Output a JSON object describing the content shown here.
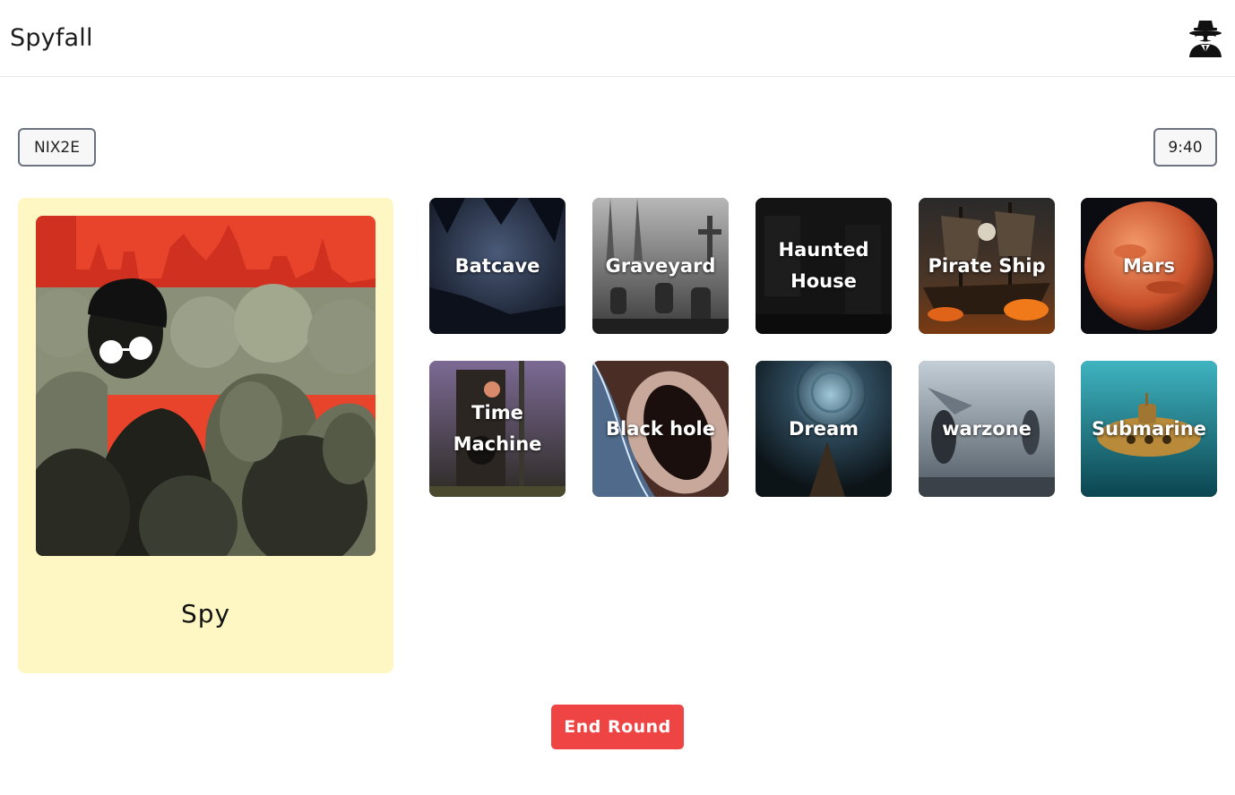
{
  "header": {
    "title": "Spyfall",
    "logo_icon": "spy-icon"
  },
  "game": {
    "room_code": "NIX2E",
    "timer": "9:40"
  },
  "role_card": {
    "role_name": "Spy",
    "image_icon": "spy-crowd-illustration"
  },
  "locations": [
    {
      "label": "Batcave"
    },
    {
      "label": "Graveyard"
    },
    {
      "label": "Haunted House"
    },
    {
      "label": "Pirate Ship"
    },
    {
      "label": "Mars"
    },
    {
      "label": "Time Machine"
    },
    {
      "label": "Black hole"
    },
    {
      "label": "Dream"
    },
    {
      "label": "warzone"
    },
    {
      "label": "Submarine"
    }
  ],
  "actions": {
    "end_round_label": "End Round"
  },
  "colors": {
    "role_card_bg": "#fef7c3",
    "end_button": "#ef4444"
  }
}
